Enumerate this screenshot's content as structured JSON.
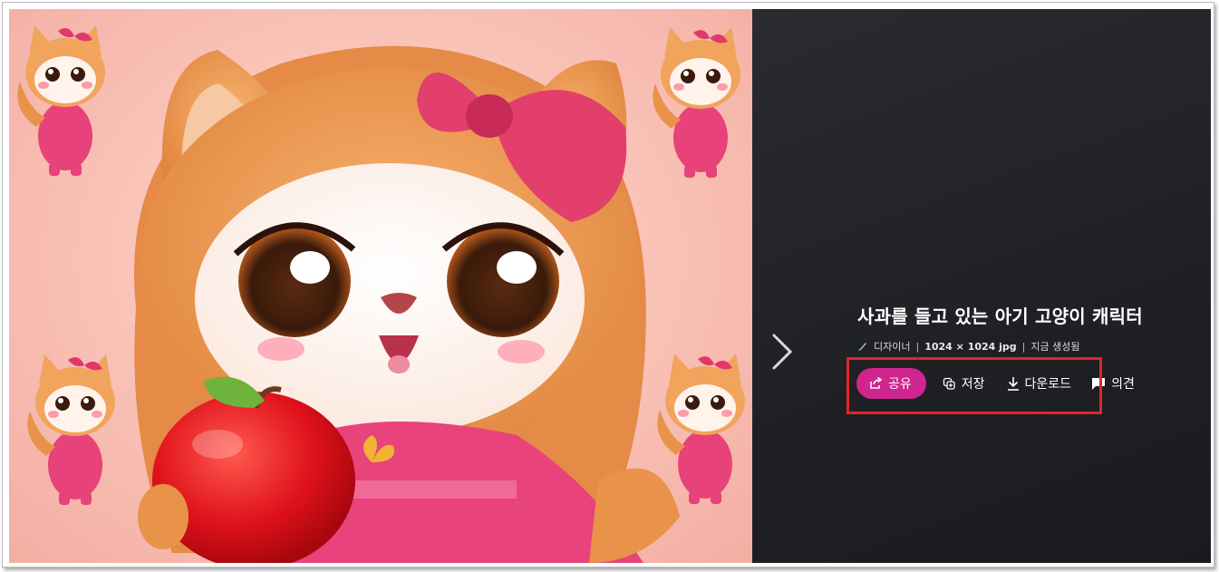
{
  "image": {
    "alt_subject": "baby cat character holding an apple"
  },
  "details": {
    "title": "사과를 들고 있는 아기 고양이 캐릭터",
    "meta": {
      "creator_label": "디자이너",
      "separator": "|",
      "dimensions": "1024 × 1024 jpg",
      "status": "지금 생성됨"
    }
  },
  "actions": {
    "share_label": "공유",
    "save_label": "저장",
    "download_label": "다운로드",
    "feedback_label": "의견"
  },
  "colors": {
    "share_accent": "#d0248f",
    "highlight_box": "#e0262b",
    "panel_bg": "#1f2024"
  },
  "icons": [
    "chevron-right-icon",
    "designer-icon",
    "share-icon",
    "save-icon",
    "download-icon",
    "comment-icon"
  ]
}
